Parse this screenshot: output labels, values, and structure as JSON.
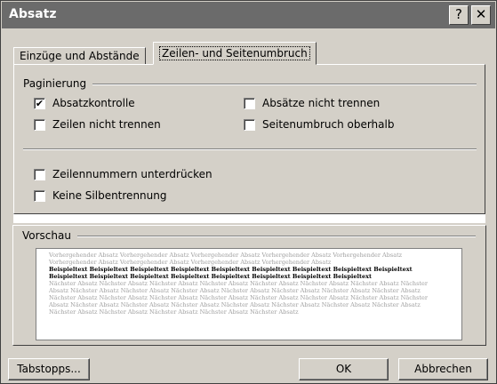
{
  "window": {
    "title": "Absatz",
    "help_button": "?",
    "close_button": "✕"
  },
  "tabs": [
    {
      "label": "Einzüge und Abstände",
      "active": false
    },
    {
      "label": "Zeilen- und Seitenumbruch",
      "active": true
    }
  ],
  "pagination": {
    "group_label": "Paginierung",
    "options": [
      {
        "label": "Absatzkontrolle",
        "checked": true
      },
      {
        "label": "Absätze nicht trennen",
        "checked": false
      },
      {
        "label": "Zeilen nicht trennen",
        "checked": false
      },
      {
        "label": "Seitenumbruch oberhalb",
        "checked": false
      }
    ]
  },
  "extra_options": [
    {
      "label": "Zeilennummern unterdrücken",
      "checked": false
    },
    {
      "label": "Keine Silbentrennung",
      "checked": false
    }
  ],
  "preview": {
    "group_label": "Vorschau",
    "before_text": "Vorhergehender Absatz Vorhergehender Absatz Vorhergehender Absatz Vorhergehender Absatz Vorhergehender Absatz Vorhergehender Absatz Vorhergehender Absatz Vorhergehender Absatz Vorhergehender Absatz",
    "sample_text": "Beispieltext Beispieltext Beispieltext Beispieltext Beispieltext Beispieltext Beispieltext Beispieltext Beispieltext Beispieltext Beispieltext Beispieltext Beispieltext Beispieltext Beispieltext Beispieltext Beispieltext",
    "after_text": "Nächster Absatz Nächster Absatz Nächster Absatz Nächster Absatz Nächster Absatz Nächster Absatz Nächster Absatz Nächster Absatz Nächster Absatz Nächster Absatz Nächster Absatz Nächster Absatz Nächster Absatz Nächster Absatz Nächster Absatz Nächster Absatz Nächster Absatz Nächster Absatz Nächster Absatz Nächster Absatz Nächster Absatz Nächster Absatz Nächster Absatz Nächster Absatz Nächster Absatz Nächster Absatz Nächster Absatz Nächster Absatz Nächster Absatz Nächster Absatz Nächster Absatz Nächster Absatz Nächster Absatz Nächster Absatz Nächster Absatz"
  },
  "buttons": {
    "tabs_label": "Tabstopps...",
    "ok_label": "OK",
    "cancel_label": "Abbrechen"
  }
}
